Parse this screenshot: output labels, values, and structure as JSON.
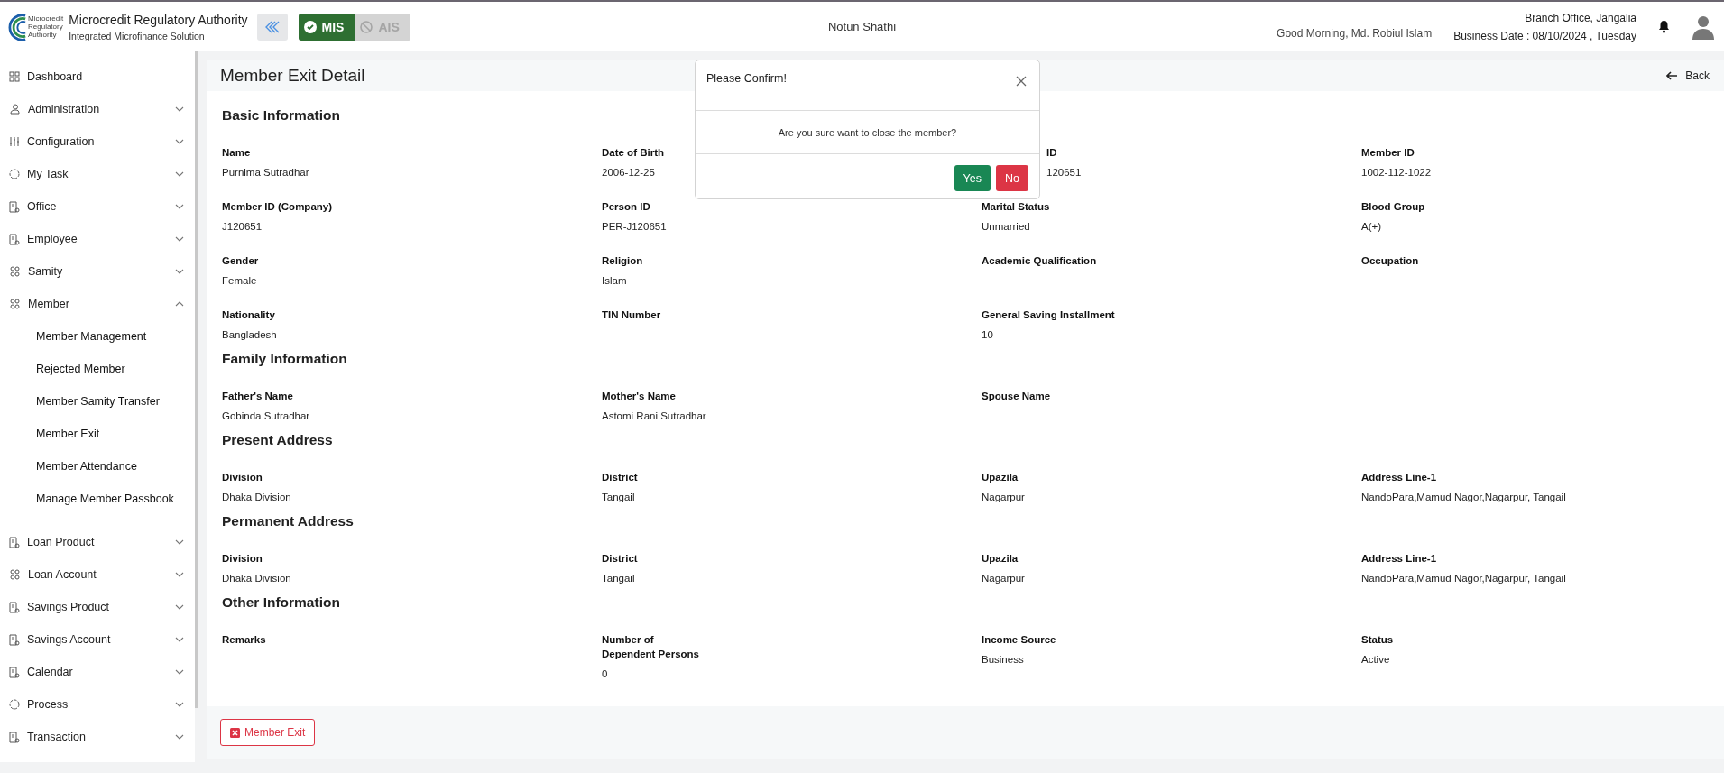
{
  "header": {
    "org_name": "Microcredit Regulatory Authority",
    "org_subtitle": "Integrated Microfinance Solution",
    "logo_text": [
      "Microcredit",
      "Regulatory",
      "Authority"
    ],
    "modules": [
      {
        "label": "MIS",
        "selected": true
      },
      {
        "label": "AIS",
        "selected": false
      }
    ],
    "app_name": "Notun Shathi",
    "greeting": "Good Morning, Md. Robiul Islam",
    "branch": "Branch Office, Jangalia",
    "business_date": "Business Date : 08/10/2024 , Tuesday"
  },
  "sidebar": {
    "items": [
      {
        "label": "Dashboard",
        "kind": "link"
      },
      {
        "label": "Administration",
        "kind": "group",
        "expanded": false
      },
      {
        "label": "Configuration",
        "kind": "group",
        "expanded": false
      },
      {
        "label": "My Task",
        "kind": "group",
        "expanded": false
      },
      {
        "label": "Office",
        "kind": "group",
        "expanded": false
      },
      {
        "label": "Employee",
        "kind": "group",
        "expanded": false
      },
      {
        "label": "Samity",
        "kind": "group",
        "expanded": false
      },
      {
        "label": "Member",
        "kind": "group",
        "expanded": true,
        "children": [
          {
            "label": "Member Management"
          },
          {
            "label": "Rejected Member"
          },
          {
            "label": "Member Samity Transfer"
          },
          {
            "label": "Member Exit"
          },
          {
            "label": "Member Attendance"
          },
          {
            "label": "Manage Member Passbook"
          }
        ]
      },
      {
        "label": "Loan Product",
        "kind": "group",
        "expanded": false
      },
      {
        "label": "Loan Account",
        "kind": "group",
        "expanded": false
      },
      {
        "label": "Savings Product",
        "kind": "group",
        "expanded": false
      },
      {
        "label": "Savings Account",
        "kind": "group",
        "expanded": false
      },
      {
        "label": "Calendar",
        "kind": "group",
        "expanded": false
      },
      {
        "label": "Process",
        "kind": "group",
        "expanded": false
      },
      {
        "label": "Transaction",
        "kind": "group",
        "expanded": false
      }
    ]
  },
  "page": {
    "title": "Member Exit Detail",
    "back": "Back",
    "sections": [
      {
        "title": "Basic Information",
        "fields": [
          {
            "label": "Name",
            "value": "Purnima Sutradhar"
          },
          {
            "label": "Date of Birth",
            "value": "2006-12-25"
          },
          {
            "label": "ID",
            "value": "120651",
            "kind": "partial"
          },
          {
            "label": "Member ID",
            "value": "1002-112-1022"
          },
          {
            "label": "Member ID (Company)",
            "value": "J120651"
          },
          {
            "label": "Person ID",
            "value": "PER-J120651"
          },
          {
            "label": "Marital Status",
            "value": "Unmarried"
          },
          {
            "label": "Blood Group",
            "value": "A(+)"
          },
          {
            "label": "Gender",
            "value": "Female"
          },
          {
            "label": "Religion",
            "value": "Islam"
          },
          {
            "label": "Academic Qualification"
          },
          {
            "label": "Occupation"
          },
          {
            "label": "Nationality",
            "value": "Bangladesh"
          },
          {
            "label": "TIN Number"
          },
          {
            "label": "General Saving Installment",
            "value": "10"
          }
        ]
      },
      {
        "title": "Family Information",
        "fields": [
          {
            "label": "Father's Name",
            "value": "Gobinda Sutradhar"
          },
          {
            "label": "Mother's Name",
            "value": "Astomi Rani Sutradhar"
          },
          {
            "label": "Spouse Name"
          }
        ]
      },
      {
        "title": "Present Address",
        "fields": [
          {
            "label": "Division",
            "value": "Dhaka Division"
          },
          {
            "label": "District",
            "value": "Tangail"
          },
          {
            "label": "Upazila",
            "value": "Nagarpur"
          },
          {
            "label": "Address Line-1",
            "value": "NandoPara,Mamud Nagor,Nagarpur, Tangail"
          }
        ]
      },
      {
        "title": "Permanent Address",
        "fields": [
          {
            "label": "Division",
            "value": "Dhaka Division"
          },
          {
            "label": "District",
            "value": "Tangail"
          },
          {
            "label": "Upazila",
            "value": "Nagarpur"
          },
          {
            "label": "Address Line-1",
            "value": "NandoPara,Mamud Nagor,Nagarpur, Tangail"
          }
        ]
      },
      {
        "title": "Other Information",
        "fields": [
          {
            "label": "Remarks"
          },
          {
            "label": "Number of Dependent Persons",
            "value": "0",
            "kind": "wrap"
          },
          {
            "label": "Income Source",
            "value": "Business"
          },
          {
            "label": "Status",
            "value": "Active"
          }
        ]
      }
    ],
    "exit_button": "Member Exit"
  },
  "modal": {
    "title": "Please Confirm!",
    "message": "Are you sure want to close the member?",
    "buttons": [
      {
        "label": "Yes",
        "kind": "confirm"
      },
      {
        "label": "No",
        "kind": "cancel"
      }
    ]
  }
}
